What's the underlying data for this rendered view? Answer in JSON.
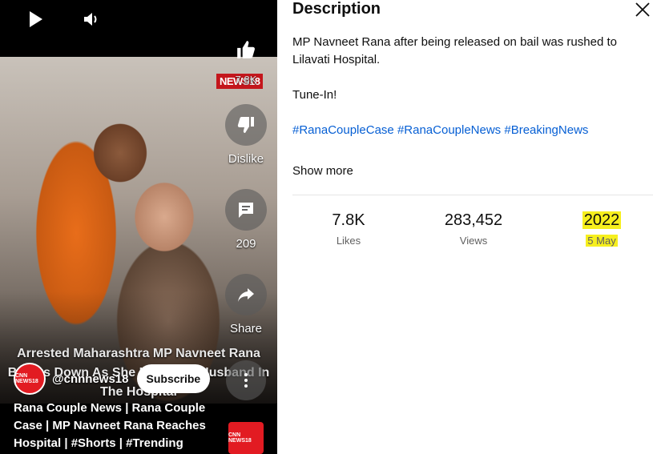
{
  "player": {
    "video_caption": "Arrested Maharashtra MP Navneet Rana Breaks Down As She Hugs Her Husband In The Hospital",
    "news_logo": "NEWS18",
    "actions": {
      "like_count": "7.8K",
      "dislike_label": "Dislike",
      "comment_count": "209",
      "share_label": "Share"
    },
    "channel": {
      "avatar_text": "CNN NEWS18",
      "handle": "@cnnnews18",
      "subscribe_label": "Subscribe"
    },
    "title": "Rana Couple News | Rana Couple Case | MP Navneet Rana Reaches Hospital | #Shorts | #Trending",
    "thumb_text": "CNN NEWS18"
  },
  "description_panel": {
    "title": "Description",
    "paragraph_1": "MP Navneet Rana after being released on bail was rushed to Lilavati Hospital.",
    "paragraph_2": "Tune-In!",
    "tags": [
      "#RanaCoupleCase",
      "#RanaCoupleNews",
      "#BreakingNews"
    ],
    "show_more_label": "Show more",
    "stats": {
      "likes_value": "7.8K",
      "likes_label": "Likes",
      "views_value": "283,452",
      "views_label": "Views",
      "year_value": "2022",
      "date_label": "5 May"
    }
  },
  "colors": {
    "link": "#065fd4",
    "highlight": "#f6ef1e",
    "brand_red": "#e21b22"
  },
  "icons": [
    "play-icon",
    "volume-icon",
    "thumb-up-icon",
    "thumb-down-icon",
    "comment-icon",
    "share-icon",
    "more-vert-icon",
    "close-icon"
  ]
}
